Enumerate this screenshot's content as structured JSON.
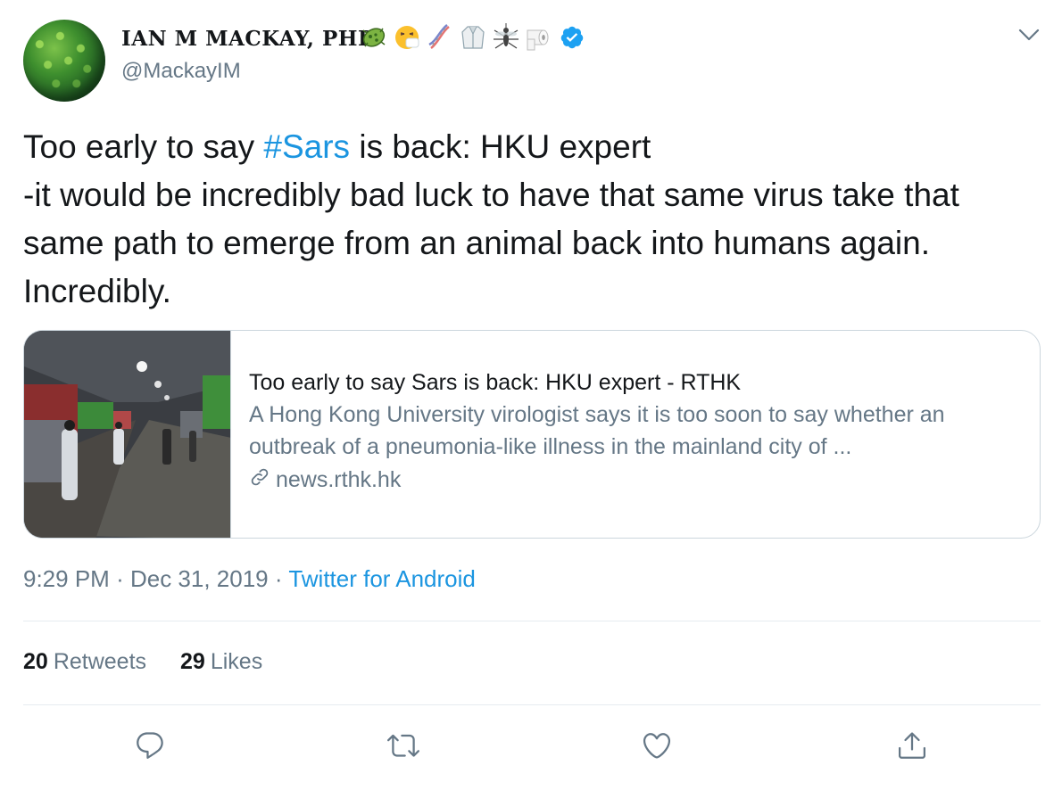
{
  "user": {
    "display_name": "IAN M MACKAY, PHD",
    "handle": "@MackayIM",
    "name_emojis": [
      "microbe-emoji",
      "sneezing-face-emoji",
      "dna-emoji",
      "lab-coat-emoji",
      "mosquito-emoji",
      "toilet-paper-emoji"
    ],
    "verified": true
  },
  "tweet": {
    "text_before_hashtag": "Too early to say ",
    "hashtag": "#Sars",
    "text_after_hashtag": " is back: HKU expert\n-it would be incredibly bad luck to have that same virus take that same path to emerge from an animal back into humans again. Incredibly."
  },
  "card": {
    "title": "Too early to say Sars is back: HKU expert - RTHK",
    "description": "A Hong Kong University virologist says it is too soon to say whether an outbreak of a pneumonia-like illness in the mainland city of ...",
    "domain": "news.rthk.hk"
  },
  "meta": {
    "time": "9:29 PM",
    "separator": "·",
    "date": "Dec 31, 2019",
    "source": "Twitter for Android"
  },
  "stats": {
    "retweets_count": "20",
    "retweets_label": "Retweets",
    "likes_count": "29",
    "likes_label": "Likes"
  },
  "colors": {
    "accent": "#1b95e0",
    "text": "#14171a",
    "secondary": "#657786",
    "border": "#ccd6dd"
  }
}
